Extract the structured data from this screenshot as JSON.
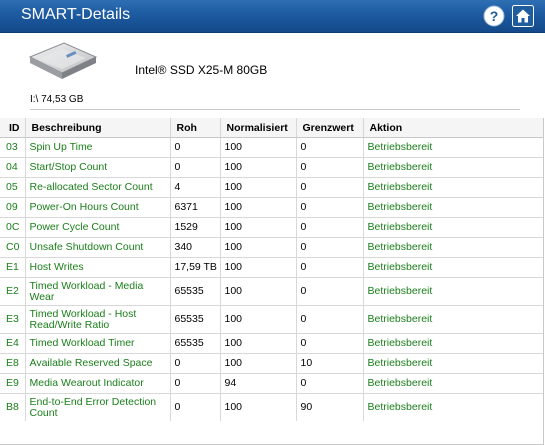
{
  "window": {
    "title": "SMART-Details",
    "help_icon": "help-icon",
    "home_icon": "home-icon"
  },
  "device": {
    "model": "Intel® SSD X25-M 80GB",
    "drive": "I:\\ 74,53 GB",
    "image": "ssd-drive-icon"
  },
  "table": {
    "headers": {
      "id": "ID",
      "description": "Beschreibung",
      "raw": "Roh",
      "normalized": "Normalisiert",
      "threshold": "Grenzwert",
      "action": "Aktion"
    },
    "rows": [
      {
        "id": "03",
        "desc": "Spin Up Time",
        "raw": "0",
        "norm": "100",
        "thresh": "0",
        "action": "Betriebsbereit"
      },
      {
        "id": "04",
        "desc": "Start/Stop Count",
        "raw": "0",
        "norm": "100",
        "thresh": "0",
        "action": "Betriebsbereit"
      },
      {
        "id": "05",
        "desc": "Re-allocated Sector Count",
        "raw": "4",
        "norm": "100",
        "thresh": "0",
        "action": "Betriebsbereit"
      },
      {
        "id": "09",
        "desc": "Power-On Hours Count",
        "raw": "6371",
        "norm": "100",
        "thresh": "0",
        "action": "Betriebsbereit"
      },
      {
        "id": "0C",
        "desc": "Power Cycle Count",
        "raw": "1529",
        "norm": "100",
        "thresh": "0",
        "action": "Betriebsbereit"
      },
      {
        "id": "C0",
        "desc": "Unsafe Shutdown Count",
        "raw": "340",
        "norm": "100",
        "thresh": "0",
        "action": "Betriebsbereit"
      },
      {
        "id": "E1",
        "desc": "Host Writes",
        "raw": "17,59 TB",
        "norm": "100",
        "thresh": "0",
        "action": "Betriebsbereit"
      },
      {
        "id": "E2",
        "desc": "Timed Workload - Media Wear",
        "raw": "65535",
        "norm": "100",
        "thresh": "0",
        "action": "Betriebsbereit"
      },
      {
        "id": "E3",
        "desc": "Timed Workload - Host Read/Write Ratio",
        "raw": "65535",
        "norm": "100",
        "thresh": "0",
        "action": "Betriebsbereit"
      },
      {
        "id": "E4",
        "desc": "Timed Workload Timer",
        "raw": "65535",
        "norm": "100",
        "thresh": "0",
        "action": "Betriebsbereit"
      },
      {
        "id": "E8",
        "desc": "Available Reserved Space",
        "raw": "0",
        "norm": "100",
        "thresh": "10",
        "action": "Betriebsbereit"
      },
      {
        "id": "E9",
        "desc": "Media Wearout Indicator",
        "raw": "0",
        "norm": "94",
        "thresh": "0",
        "action": "Betriebsbereit"
      },
      {
        "id": "B8",
        "desc": "End-to-End Error Detection Count",
        "raw": "0",
        "norm": "100",
        "thresh": "90",
        "action": "Betriebsbereit"
      }
    ]
  },
  "colors": {
    "title_bar": "#1d5aa0",
    "ok_text": "#1a7f1a"
  }
}
